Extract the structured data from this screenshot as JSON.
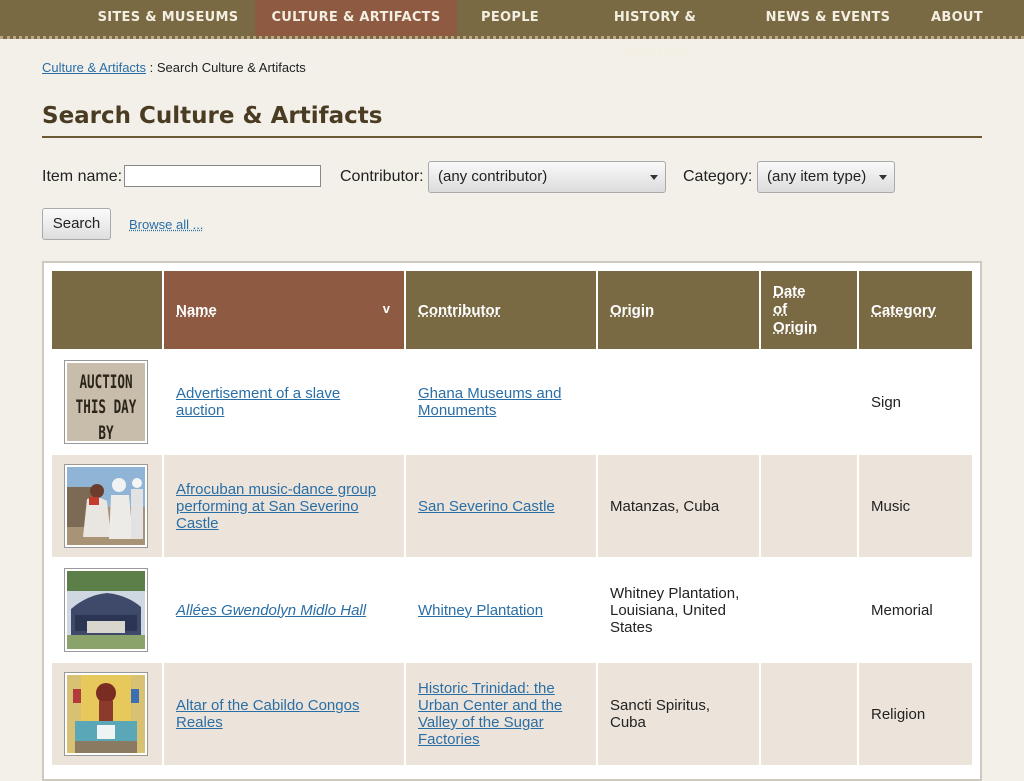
{
  "nav": {
    "items": [
      {
        "label": "SITES & MUSEUMS"
      },
      {
        "label": "CULTURE & ARTIFACTS"
      },
      {
        "label": "PEOPLE"
      },
      {
        "label": "HISTORY & MEMORY"
      },
      {
        "label": "NEWS & EVENTS"
      },
      {
        "label": "ABOUT"
      }
    ]
  },
  "breadcrumb": {
    "link": "Culture & Artifacts",
    "sep": " : ",
    "current": "Search Culture & Artifacts"
  },
  "page": {
    "title": "Search Culture & Artifacts"
  },
  "search": {
    "item_name_label": "Item name:",
    "item_name_value": "",
    "contributor_label": "Contributor:",
    "contributor_selected": "(any contributor)",
    "category_label": "Category:",
    "category_selected": "(any item type)",
    "search_button": "Search",
    "browse_link": "Browse all ..."
  },
  "table": {
    "headers": {
      "name": "Name",
      "contributor": "Contributor",
      "origin": "Origin",
      "date_line1": "Date",
      "date_line2": "of",
      "date_line3": "Origin",
      "category": "Category",
      "sort_indicator": "v"
    },
    "rows": [
      {
        "name": "Advertisement of a slave auction",
        "contributor": "Ghana Museums and Monuments",
        "origin": "",
        "date": "",
        "category": "Sign"
      },
      {
        "name": "Afrocuban music-dance group performing at San Severino Castle",
        "contributor": "San Severino Castle",
        "origin": "Matanzas, Cuba",
        "date": "",
        "category": "Music"
      },
      {
        "name": "Allées Gwendolyn Midlo Hall",
        "contributor": "Whitney Plantation",
        "origin": "Whitney Plantation, Louisiana, United States",
        "date": "",
        "category": "Memorial"
      },
      {
        "name": "Altar of the Cabildo Congos Reales",
        "contributor": "Historic Trinidad: the Urban Center and the Valley of the Sugar Factories",
        "origin": "Sancti Spiritus, Cuba",
        "date": "",
        "category": "Religion"
      }
    ],
    "thumb1_text": [
      "AUCTION",
      "THIS DAY",
      "BY"
    ]
  },
  "colors": {
    "nav_bg": "#7a6a44",
    "nav_active": "#8e5a42",
    "link": "#2a6ea6",
    "row_alt": "#ece4da"
  }
}
